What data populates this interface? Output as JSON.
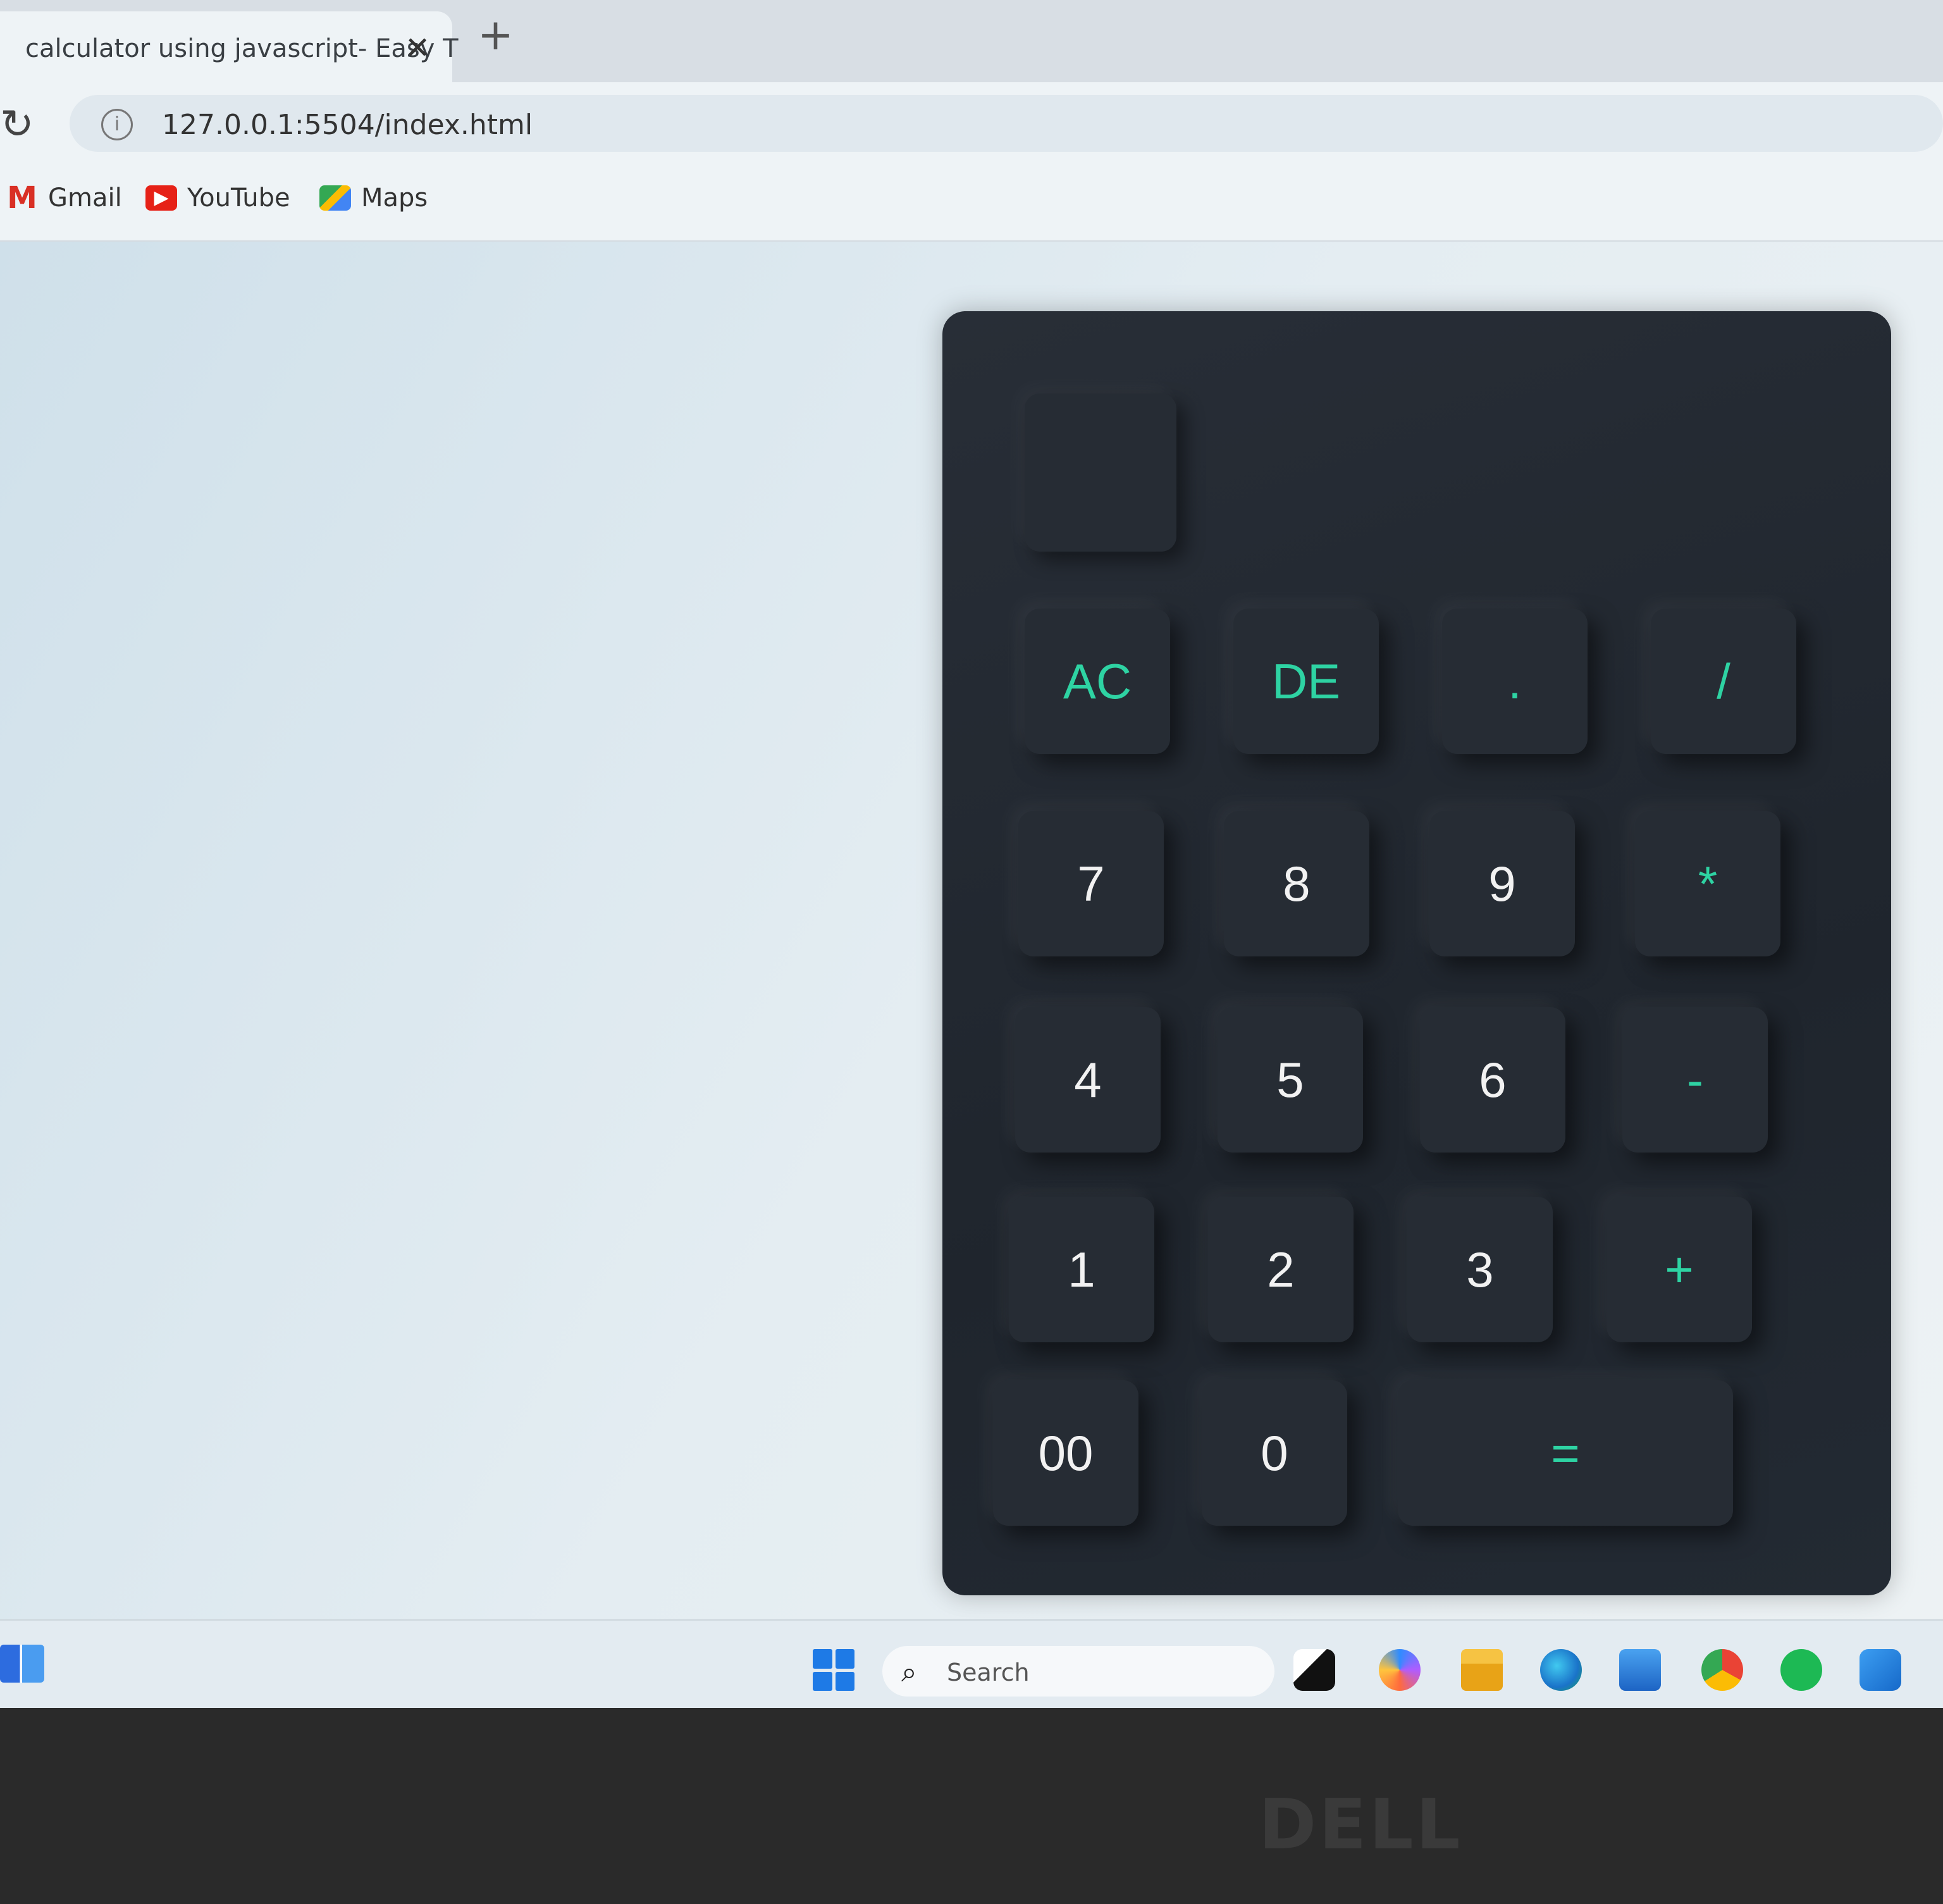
{
  "browser": {
    "tab_title": "calculator using javascript- Easy T",
    "tab_close": "✕",
    "new_tab": "+",
    "reload": "↻",
    "url": "127.0.0.1:5504/index.html",
    "info": "i"
  },
  "bookmarks": [
    {
      "label": "Gmail",
      "icon": "gmail-icon"
    },
    {
      "label": "YouTube",
      "icon": "youtube-icon"
    },
    {
      "label": "Maps",
      "icon": "maps-icon"
    }
  ],
  "calculator": {
    "display_value": "",
    "accent_color": "#2ed3a3",
    "keys": {
      "ac": "AC",
      "de": "DE",
      "dot": ".",
      "div": "/",
      "k7": "7",
      "k8": "8",
      "k9": "9",
      "mul": "*",
      "k4": "4",
      "k5": "5",
      "k6": "6",
      "sub": "-",
      "k1": "1",
      "k2": "2",
      "k3": "3",
      "add": "+",
      "k00": "00",
      "k0": "0",
      "eq": "="
    }
  },
  "taskbar": {
    "search_label": "Search",
    "apps": [
      "widgets-icon",
      "start-icon",
      "search-icon",
      "task-view-icon",
      "copilot-icon",
      "file-explorer-icon",
      "edge-icon",
      "mail-icon",
      "chrome-icon",
      "spotify-icon",
      "vscode-icon"
    ]
  },
  "bezel": {
    "logo": "DELL"
  }
}
